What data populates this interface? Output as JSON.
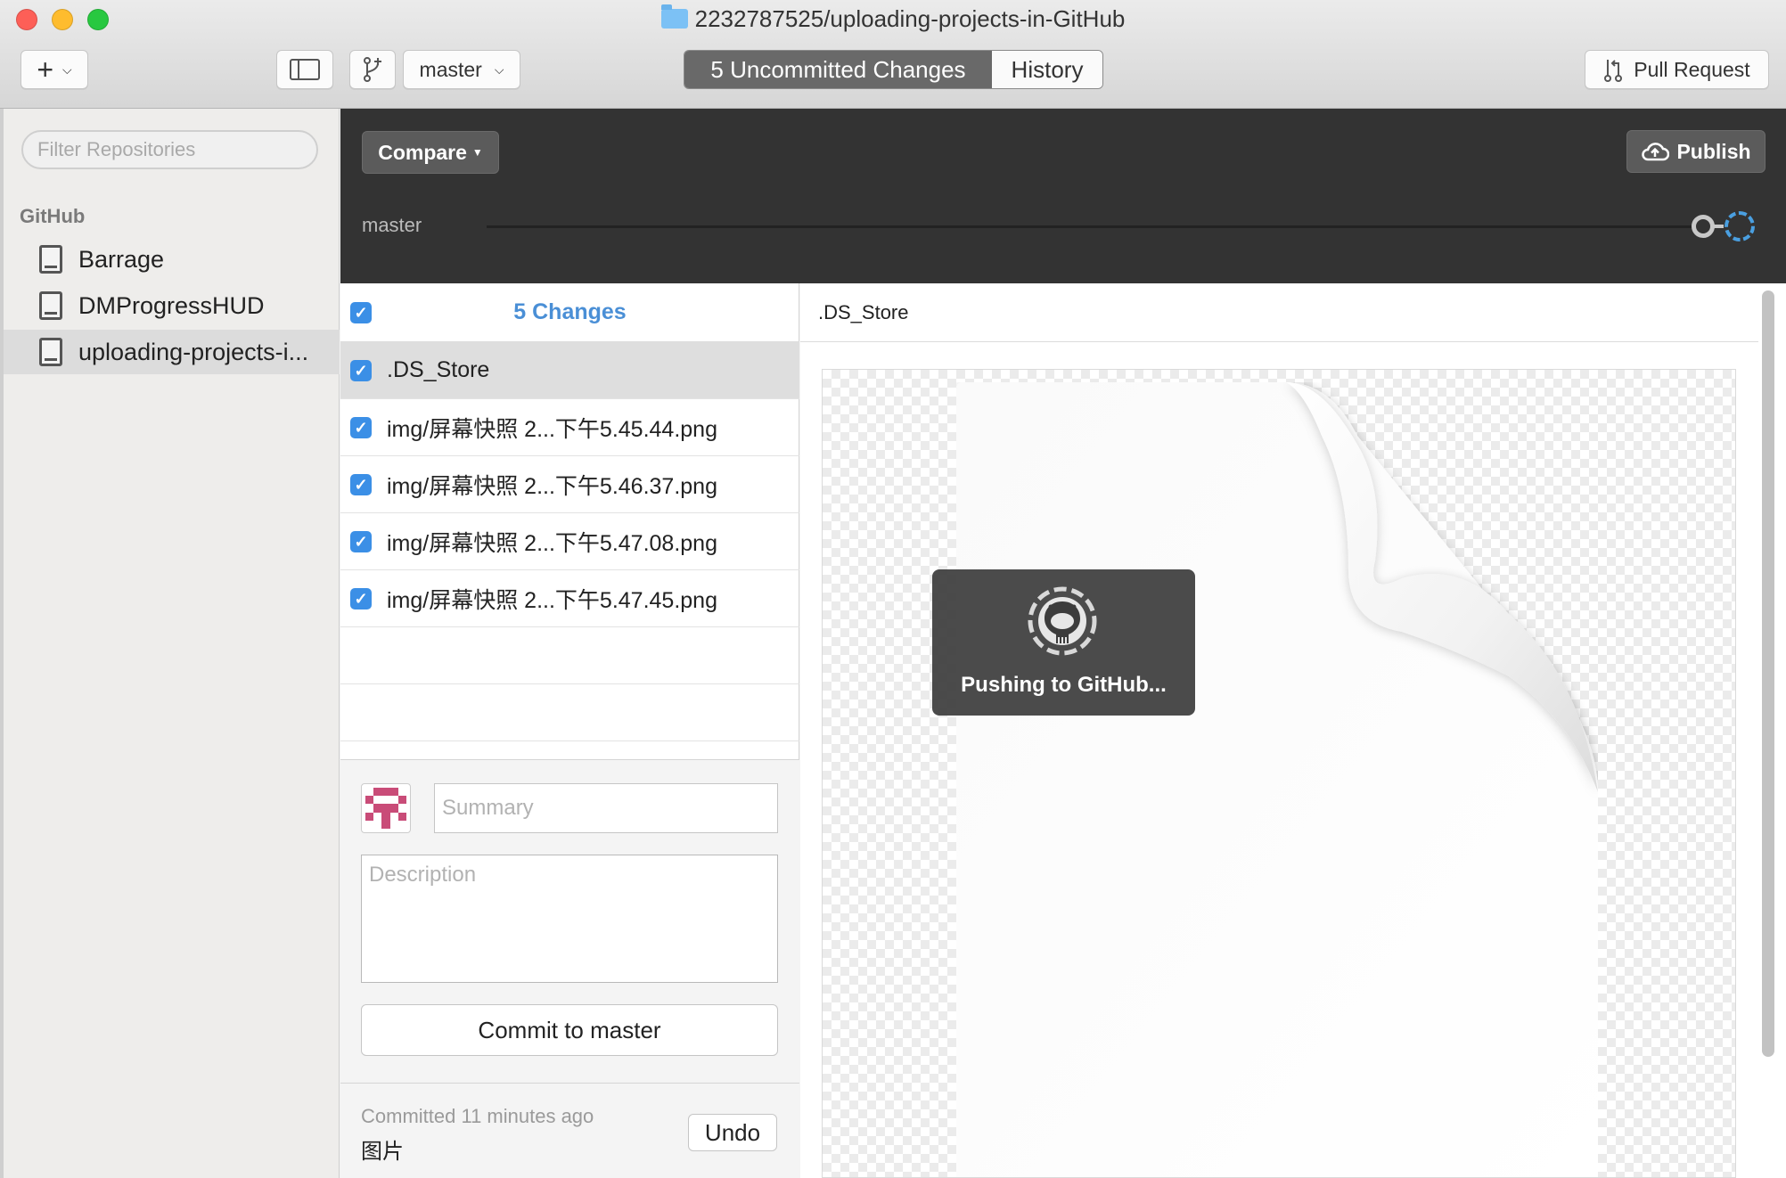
{
  "window": {
    "title": "2232787525/uploading-projects-in-GitHub"
  },
  "toolbar": {
    "add_label": "+",
    "branch_name": "master",
    "tab_uncommitted": "5 Uncommitted Changes",
    "tab_history": "History",
    "pull_request_label": "Pull Request"
  },
  "sidebar": {
    "filter_placeholder": "Filter Repositories",
    "section_title": "GitHub",
    "repos": [
      {
        "name": "Barrage",
        "selected": false
      },
      {
        "name": "DMProgressHUD",
        "selected": false
      },
      {
        "name": "uploading-projects-i...",
        "selected": true
      }
    ]
  },
  "header": {
    "compare_label": "Compare",
    "publish_label": "Publish",
    "branch_label": "master"
  },
  "changes": {
    "title": "5 Changes",
    "files": [
      {
        "name": ".DS_Store",
        "checked": true,
        "selected": true
      },
      {
        "name": "img/屏幕快照 2...下午5.45.44.png",
        "checked": true,
        "selected": false
      },
      {
        "name": "img/屏幕快照 2...下午5.46.37.png",
        "checked": true,
        "selected": false
      },
      {
        "name": "img/屏幕快照 2...下午5.47.08.png",
        "checked": true,
        "selected": false
      },
      {
        "name": "img/屏幕快照 2...下午5.47.45.png",
        "checked": true,
        "selected": false
      }
    ]
  },
  "commit": {
    "summary_placeholder": "Summary",
    "description_placeholder": "Description",
    "commit_button": "Commit to master",
    "last_commit_time": "Committed 11 minutes ago",
    "last_commit_message": "图片",
    "undo_label": "Undo"
  },
  "diff": {
    "filename": ".DS_Store"
  },
  "hud": {
    "message": "Pushing to GitHub..."
  },
  "colors": {
    "accent": "#3b8fe6",
    "header_dark": "#333333",
    "changes_title": "#4a8fd6",
    "avatar": "#c94c78"
  }
}
